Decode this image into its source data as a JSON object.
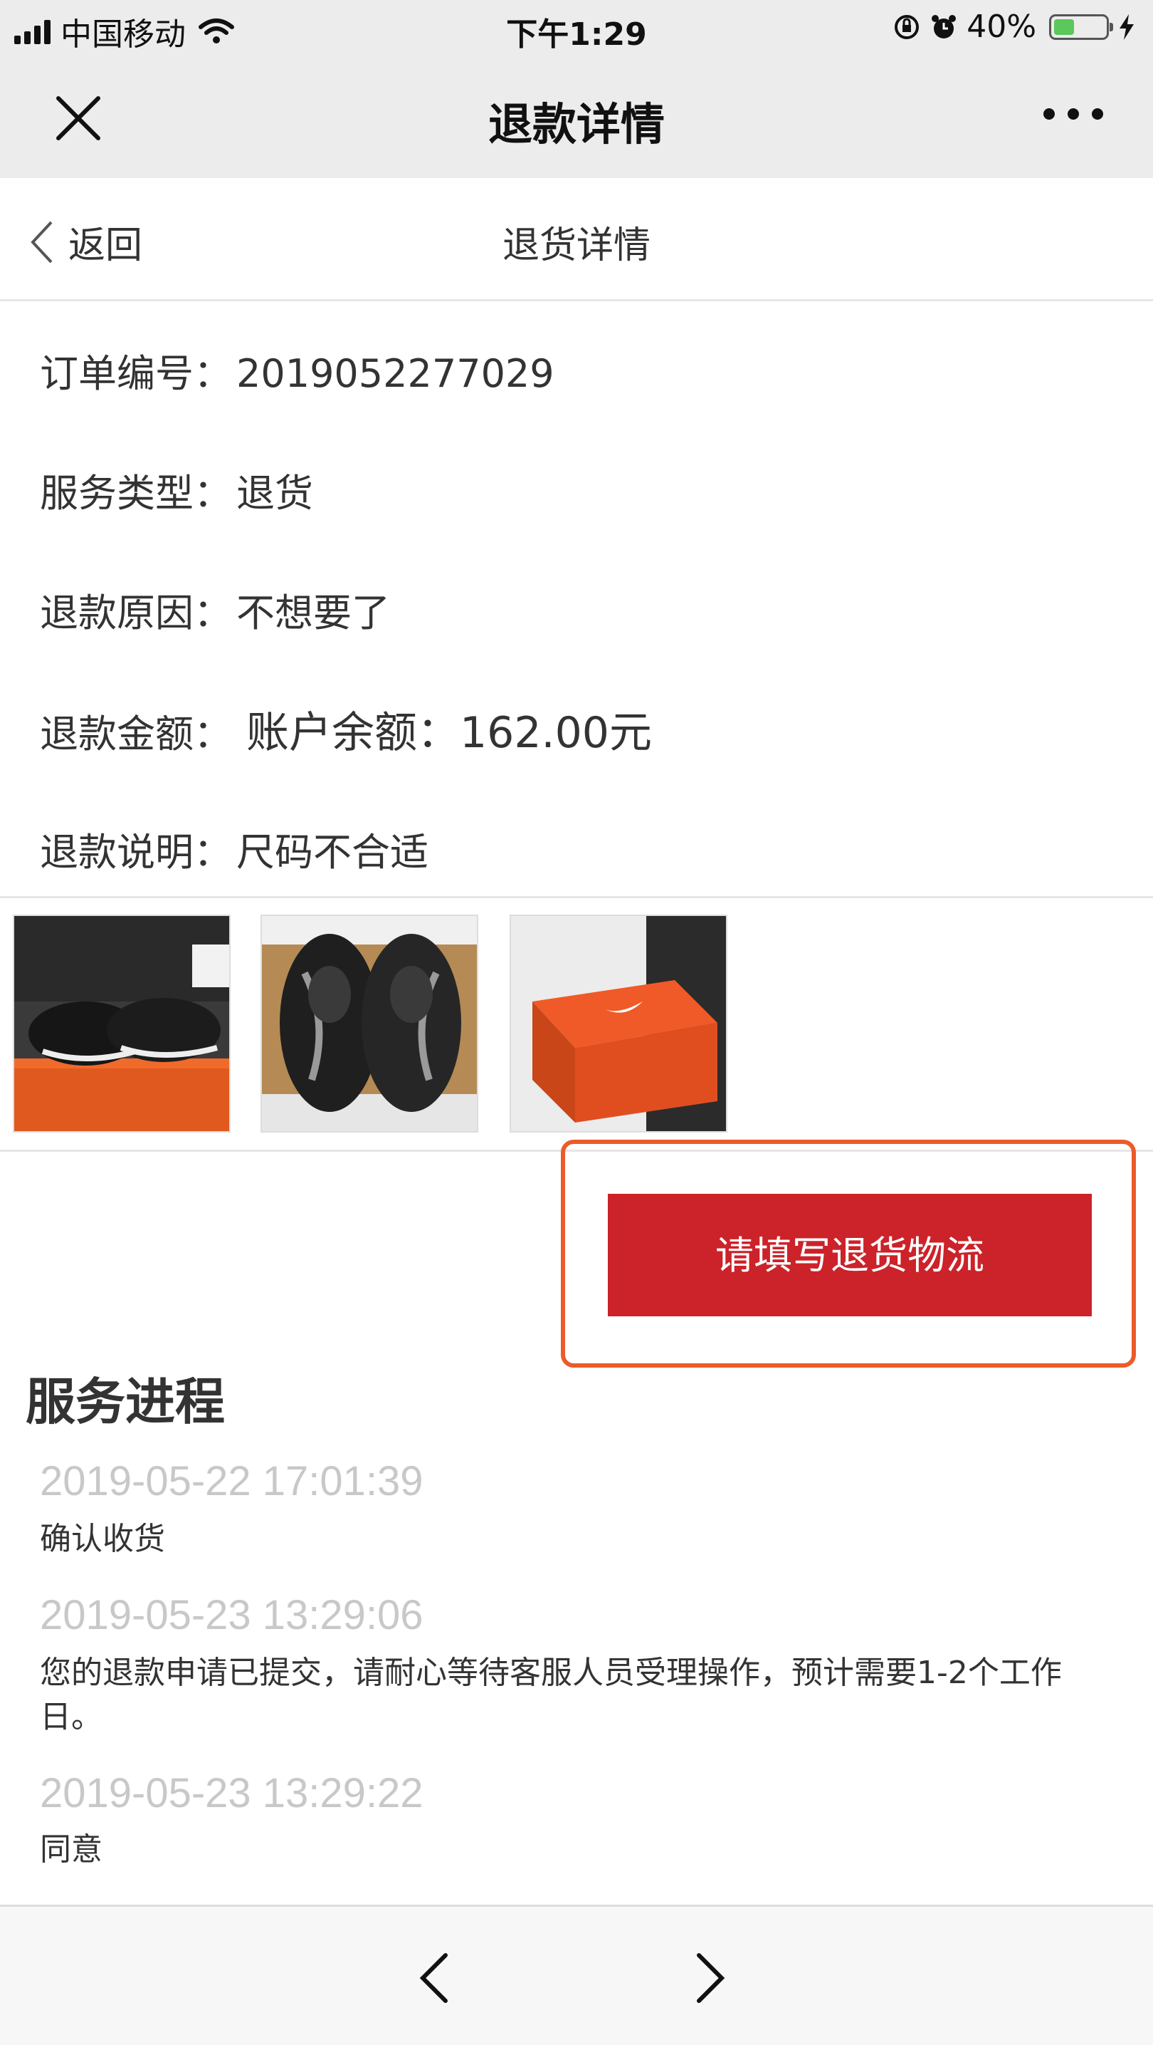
{
  "status_bar": {
    "carrier": "中国移动",
    "time": "下午1:29",
    "battery": "40%",
    "battery_level": 0.4,
    "icons": [
      "signal-icon",
      "wifi-icon",
      "orientation-lock-icon",
      "alarm-icon",
      "battery-icon",
      "charging-icon"
    ]
  },
  "navbar": {
    "title": "退款详情",
    "close_icon": "close-icon",
    "more_icon": "more-icon"
  },
  "subheader": {
    "back_label": "返回",
    "title": "退货详情"
  },
  "info": {
    "order_no_label": "订单编号：",
    "order_no": "2019052277029",
    "service_type_label": "服务类型：",
    "service_type": "退货",
    "reason_label": "退款原因：",
    "reason": "不想要了",
    "amount_label": "退款金额：",
    "amount": "账户余额：162.00元",
    "note_label": "退款说明：",
    "note": "尺码不合适"
  },
  "photos": [
    "shoes-on-box-photo",
    "shoe-soles-photo",
    "orange-shoebox-photo"
  ],
  "action": {
    "fill_logistics_label": "请填写退货物流",
    "highlight_color": "#ec5b2a",
    "button_color": "#cc2229"
  },
  "progress": {
    "title": "服务进程",
    "events": [
      {
        "time": "2019-05-22 17:01:39",
        "text": "确认收货"
      },
      {
        "time": "2019-05-23 13:29:06",
        "text": "您的退款申请已提交，请耐心等待客服人员受理操作，预计需要1-2个工作日。"
      },
      {
        "time": "2019-05-23 13:29:22",
        "text": "同意"
      }
    ]
  },
  "toolbar": {
    "back_icon": "chevron-left-icon",
    "forward_icon": "chevron-right-icon"
  }
}
